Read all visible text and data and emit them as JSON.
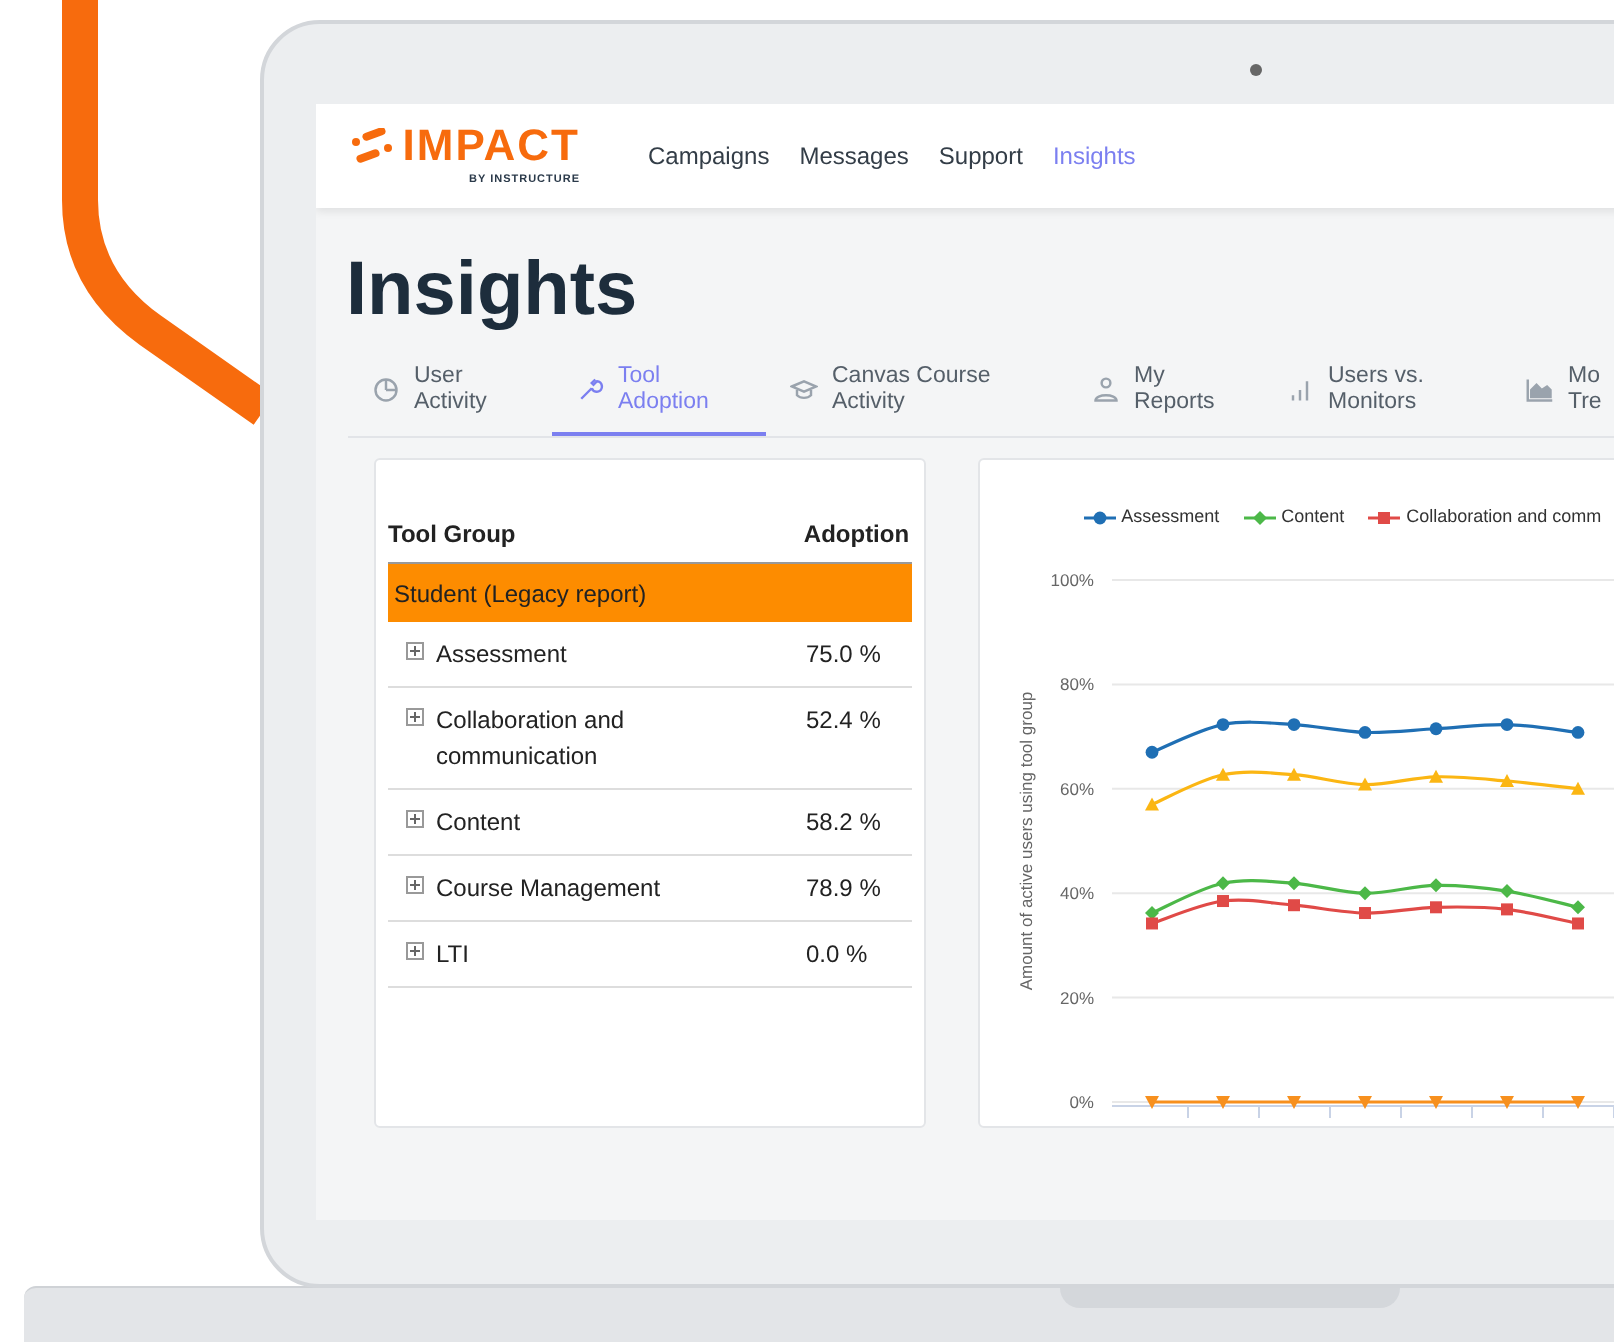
{
  "header": {
    "logo": {
      "name": "IMPACT",
      "tagline": "BY INSTRUCTURE"
    },
    "nav": [
      {
        "label": "Campaigns",
        "selected": false
      },
      {
        "label": "Messages",
        "selected": false
      },
      {
        "label": "Support",
        "selected": false
      },
      {
        "label": "Insights",
        "selected": true
      }
    ]
  },
  "page_title": "Insights",
  "tabs": [
    {
      "lines": [
        "User",
        "Activity"
      ],
      "selected": false
    },
    {
      "lines": [
        "Tool",
        "Adoption"
      ],
      "selected": true
    },
    {
      "lines": [
        "Canvas Course",
        "Activity"
      ],
      "selected": false
    },
    {
      "lines": [
        "My",
        "Reports"
      ],
      "selected": false
    },
    {
      "lines": [
        "Users vs.",
        "Monitors"
      ],
      "selected": false
    },
    {
      "lines": [
        "Mo",
        "Tre"
      ],
      "selected": false
    }
  ],
  "table": {
    "columns": [
      "Tool Group",
      "Adoption"
    ],
    "group_row": "Student (Legacy report)",
    "rows": [
      {
        "name": "Assessment",
        "adoption": "75.0 %",
        "expanded": false
      },
      {
        "name": "Collaboration and communication",
        "adoption": "52.4 %",
        "expanded": false
      },
      {
        "name": "Content",
        "adoption": "58.2 %",
        "expanded": false
      },
      {
        "name": "Course Management",
        "adoption": "78.9 %",
        "expanded": false
      },
      {
        "name": "LTI",
        "adoption": "0.0 %",
        "expanded": false
      }
    ]
  },
  "chart": {
    "chart_data": {
      "type": "line",
      "grid": true,
      "legend": true,
      "ylabel": "Amount of active users using tool group",
      "ylim": [
        0,
        100
      ],
      "yticks": [
        {
          "value": 0,
          "label": "0%"
        },
        {
          "value": 20,
          "label": "20%"
        },
        {
          "value": 40,
          "label": "40%"
        },
        {
          "value": 60,
          "label": "60%"
        },
        {
          "value": 80,
          "label": "80%"
        },
        {
          "value": 100,
          "label": "100%"
        }
      ],
      "series": [
        {
          "name": "Assessment",
          "color": "#1f6fb4",
          "marker": "circle",
          "values": [
            67,
            72.3,
            72.3,
            70.8,
            71.5,
            72.3,
            70.8
          ]
        },
        {
          "name": "Content",
          "color": "#4cb848",
          "marker": "diamond",
          "values": [
            36.2,
            41.9,
            41.9,
            40,
            41.5,
            40.4,
            37.3
          ]
        },
        {
          "name": "Collaboration and comm",
          "color": "#e04a47",
          "marker": "square",
          "values": [
            34.2,
            38.5,
            37.7,
            36.2,
            37.3,
            36.9,
            34.2
          ]
        },
        {
          "color": "#fbb613",
          "marker": "triangle-up",
          "values": [
            57,
            62.7,
            62.7,
            60.8,
            62.3,
            61.5,
            60
          ]
        },
        {
          "color": "#f7901e",
          "marker": "triangle-down",
          "values": [
            0,
            0,
            0,
            0,
            0,
            0,
            0
          ]
        }
      ]
    }
  }
}
